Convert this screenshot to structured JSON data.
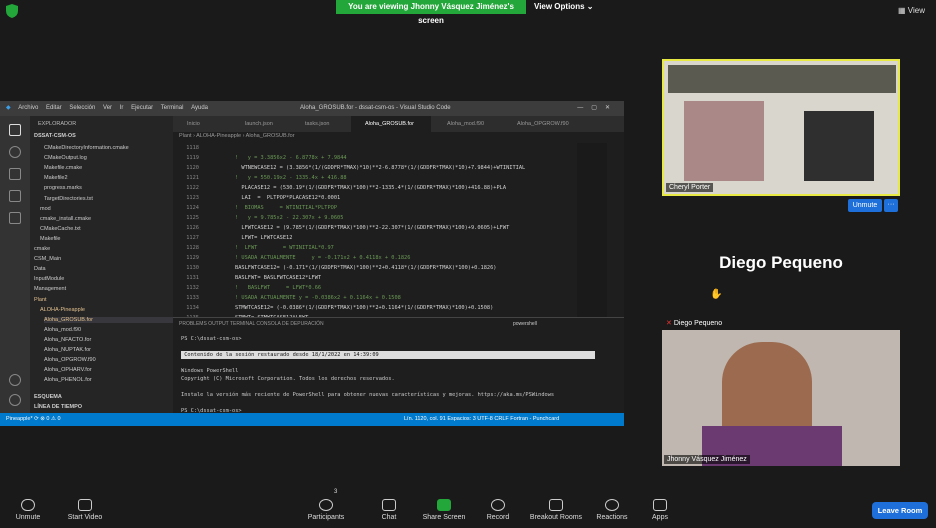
{
  "zoom": {
    "banner": "You are viewing Jhonny Vásquez Jiménez's screen",
    "view_options": "View Options ⌄",
    "view_button": "▦ View",
    "participant1_name": "Cheryl Porter",
    "unmute_btn": "Unmute",
    "more_btn": "···",
    "participant2_big_name": "Diego Pequeno",
    "participant2_label": "Diego Pequeno",
    "participant3_name": "Jhonny Vásquez Jiménez",
    "participants_count": "3",
    "toolbar": {
      "unmute": "Unmute",
      "start_video": "Start Video",
      "participants": "Participants",
      "chat": "Chat",
      "share_screen": "Share Screen",
      "record": "Record",
      "breakout": "Breakout Rooms",
      "reactions": "Reactions",
      "apps": "Apps",
      "leave": "Leave Room"
    }
  },
  "vscode": {
    "menu": [
      "Archivo",
      "Editar",
      "Selección",
      "Ver",
      "Ir",
      "Ejecutar",
      "Terminal",
      "Ayuda"
    ],
    "title": "Aloha_GROSUB.for - dssat-csm-os - Visual Studio Code",
    "explorer_title": "EXPLORADOR",
    "workspace": "DSSAT-CSM-OS",
    "sidebar_items": [
      "CMakeDirectoryInformation.cmake",
      "CMakeOutput.log",
      "Makefile.cmake",
      "Makefile2",
      "progress.marks",
      "TargetDirectories.txt",
      "mod",
      "cmake_install.cmake",
      "CMakeCache.txt",
      "Makefile",
      "cmake",
      "CSM_Main",
      "Data",
      "InputModule",
      "Management",
      "Plant",
      "ALOHA-Pineapple",
      "Aloha_GROSUB.for",
      "Aloha_mod.f90",
      "Aloha_NFACTO.for",
      "Aloha_NUPTAK.for",
      "Aloha_OPGROW.f90",
      "Aloha_OPHARV.for",
      "Aloha_PHENOL.for"
    ],
    "esquema": "ESQUEMA",
    "timeline": "LÍNEA DE TIEMPO",
    "tabs": [
      "Inicio",
      "launch.json",
      "tasks.json",
      "Aloha_GROSUB.for",
      "Aloha_mod.f90",
      "Aloha_OPGROW.f90"
    ],
    "breadcrumb": "Plant › ALOHA-Pineapple › Aloha_GROSUB.for",
    "line_numbers": [
      "1118",
      "1119",
      "1120",
      "1121",
      "1122",
      "1123",
      "1124",
      "1125",
      "1126",
      "1127",
      "1128",
      "1129",
      "1130",
      "1131",
      "1132",
      "1133",
      "1134",
      "1135"
    ],
    "code_lines": [
      "",
      "!   y = 3.3856x2 - 6.8778x + 7.9844",
      "  WTNEWCASE12 = (3.3856*(1/(GDDFR*TMAX)*10)**2-6.8778*(1/(GDDFR*TMAX)*10)+7.9844)+WTINITIAL",
      "!   y = 550.19x2 - 1335.4x + 416.88",
      "  PLACASE12 = (530.19*(1/(GDDFR*TMAX)*100)**2-1335.4*(1/(GDDFR*TMAX)*100)+416.88)+PLA",
      "  LAI  =  PLTPOP*PLACASE12*0.0001",
      "!  BIOMAS     = WTINITIAL*PLTPOP",
      "!   y = 9.785x2 - 22.307x + 9.0605",
      "  LFWTCASE12 = (9.785*(1/(GDDFR*TMAX)*100)**2-22.307*(1/(GDDFR*TMAX)*100)+9.0605)+LFWT",
      "  LFWT= LFWTCASE12",
      "!  LFWT        = WTINITIAL*0.97",
      "! USADA ACTUALMENTE     y = -0.171x2 + 0.4118x + 0.1826",
      "BASLFWTCASE12= (-0.171*(1/(GDDFR*TMAX)*100)**2+0.4118*(1/(GDDFR*TMAX)*100)+0.1826)",
      "BASLFWT= BASLFWTCASE12*LFWT",
      "!   BASLFWT     = LFWT*0.66",
      "! USADA ACTUALMENTE y = -0.0386x2 + 0.1164x + 0.1508",
      "STMWTCASE12= (-0.0386*(1/(GDDFR*TMAX)*100)**2+0.1164*(1/(GDDFR*TMAX)*100)+0.1508)",
      "STMWT= STMWTCASE12*LFWT"
    ],
    "panel_tabs": "PROBLEMS    OUTPUT    TERMINAL    CONSOLA DE DEPURACIÓN",
    "terminal_shell": "powershell",
    "terminal_lines": [
      "PS C:\\dssat-csm-os>",
      "",
      " Contenido de la sesión restaurado desde 18/1/2022 en 14:39:09",
      "",
      "Windows PowerShell",
      "Copyright (C) Microsoft Corporation. Todos los derechos reservados.",
      "",
      "Instale la versión más reciente de PowerShell para obtener nuevas características y mejoras. https://aka.ms/PSWindows",
      "",
      "PS C:\\dssat-csm-os>"
    ],
    "status_left": "Pineapple*  ⟳  ⊗ 0 ⚠ 0",
    "status_right": "Lín. 1120, col. 91   Espacios: 3   UTF-8   CRLF   Fortran - Punchcard"
  }
}
